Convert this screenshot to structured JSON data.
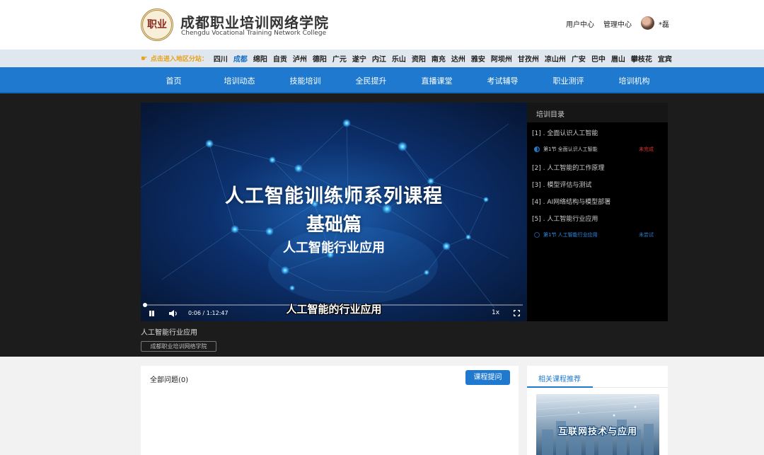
{
  "header": {
    "logo_seal_text": "职业",
    "logo_cn": "成都职业培训网络学院",
    "logo_en": "Chengdu Vocational Training Network College",
    "user_center": "用户中心",
    "admin_center": "管理中心",
    "username": "*磊"
  },
  "region_bar": {
    "prompt": "点击进入地区分站：",
    "items": [
      "四川",
      "成都",
      "绵阳",
      "自贡",
      "泸州",
      "德阳",
      "广元",
      "遂宁",
      "内江",
      "乐山",
      "资阳",
      "南充",
      "达州",
      "雅安",
      "阿坝州",
      "甘孜州",
      "凉山州",
      "广安",
      "巴中",
      "眉山",
      "攀枝花",
      "宜宾"
    ],
    "active": "成都"
  },
  "nav": {
    "items": [
      "首页",
      "培训动态",
      "技能培训",
      "全民提升",
      "直播课堂",
      "考试辅导",
      "职业测评",
      "培训机构"
    ]
  },
  "video": {
    "title": "人工智能训练师系列课程",
    "subtitle1": "基础篇",
    "subtitle2": "人工智能行业应用",
    "caption": "人工智能的行业应用",
    "time": "0:06 / 1:12:47",
    "progress": 0.0014,
    "speed": "1x"
  },
  "catalog": {
    "title": "培训目录",
    "entries": [
      {
        "type": "chapter",
        "text": "[1] . 全面认识人工智能"
      },
      {
        "type": "lesson",
        "text": "第1节 全面认识人工智能",
        "status": "未完成",
        "status_color": "#e0302a",
        "text_color": "#cccccc",
        "dot": "half"
      },
      {
        "type": "chapter",
        "text": "[2] . 人工智能的工作原理"
      },
      {
        "type": "chapter",
        "text": "[3] . 模型评估与测试"
      },
      {
        "type": "chapter",
        "text": "[4] . AI网络结构与模型部署"
      },
      {
        "type": "chapter",
        "text": "[5] . 人工智能行业应用"
      },
      {
        "type": "lesson",
        "text": "第1节 人工智能行业应用",
        "status": "未尝试",
        "status_color": "#2a78c8",
        "text_color": "#2a8ee8",
        "dot": "empty"
      }
    ]
  },
  "course": {
    "title": "人工智能行业应用",
    "org": "成都职业培训网络学院"
  },
  "qa": {
    "title": "全部问题(0)",
    "ask_button": "课程提问"
  },
  "related": {
    "title": "相关课程推荐",
    "thumb_text": "互联网技术与应用"
  }
}
